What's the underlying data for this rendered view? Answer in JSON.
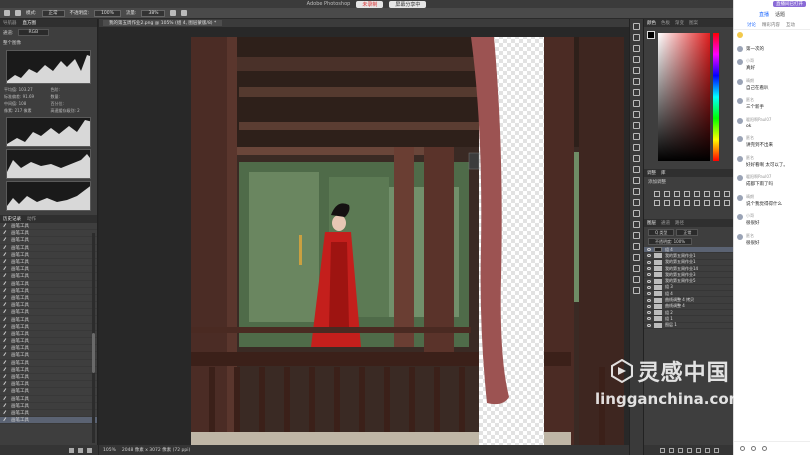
{
  "window": {
    "title": "Adobe Photoshop",
    "record_button": "未录制",
    "share_button": "屏幕分享中"
  },
  "options_bar": {
    "mode_label": "模式:",
    "mode_value": "正常",
    "opacity_label": "不透明度:",
    "opacity_value": "100%",
    "flow_label": "流量:",
    "flow_value": "38%"
  },
  "document": {
    "tab_label": "我的第五周作业2.png @ 105% (组 4, 图层蒙版/8) *",
    "status_zoom": "105%",
    "status_info": "2048 像素 x 3072 像素 (72 ppi)"
  },
  "left_panel": {
    "tabs": [
      "导航器",
      "直方图"
    ],
    "active_tab": "直方图",
    "channel_label": "通道:",
    "channel_value": "RGB",
    "source_label": "整个图像",
    "stats": [
      "平均值: 103.27",
      "色阶:",
      "标准偏差: 91.69",
      "数量:",
      "中间值: 108",
      "百分位:",
      "像素: 217 像素",
      "高速缓存级别: 2"
    ],
    "history_tabs": [
      "历史记录",
      "动作"
    ],
    "history_items": [
      "画笔工具",
      "画笔工具",
      "画笔工具",
      "画笔工具",
      "画笔工具",
      "画笔工具",
      "画笔工具",
      "画笔工具",
      "画笔工具",
      "画笔工具",
      "画笔工具",
      "画笔工具",
      "画笔工具",
      "画笔工具",
      "画笔工具",
      "画笔工具",
      "画笔工具",
      "画笔工具",
      "画笔工具",
      "画笔工具",
      "画笔工具",
      "画笔工具",
      "画笔工具",
      "画笔工具",
      "画笔工具",
      "画笔工具",
      "画笔工具",
      "画笔工具"
    ]
  },
  "right_panel": {
    "color_tabs": [
      "颜色",
      "色板",
      "渐变",
      "图案"
    ],
    "adjust_tabs": [
      "调整",
      "库"
    ],
    "adjust_label": "添加调整",
    "layers_tabs": [
      "图层",
      "通道",
      "路径"
    ],
    "layer_kind": "Q 类型",
    "layer_blend": "正常",
    "layer_opacity": "不透明度: 100%",
    "layers": [
      {
        "name": "组 4",
        "active": true
      },
      {
        "name": "我的第五周作业1",
        "active": false
      },
      {
        "name": "我的第五周作业1",
        "active": false
      },
      {
        "name": "我的第五周作业14",
        "active": false
      },
      {
        "name": "我的第五周作业3",
        "active": false
      },
      {
        "name": "我的第五周作业5",
        "active": false
      },
      {
        "name": "组 3",
        "active": false
      },
      {
        "name": "组 4",
        "active": false
      },
      {
        "name": "曲线调整 4 拷贝",
        "active": false
      },
      {
        "name": "曲线调整 4",
        "active": false
      },
      {
        "name": "组 2",
        "active": false
      },
      {
        "name": "组 1",
        "active": false
      },
      {
        "name": "图层 1",
        "active": false
      }
    ]
  },
  "chat": {
    "badge": "直播间已打开",
    "head_tabs": [
      "直播",
      "话题"
    ],
    "active_head": "直播",
    "sub_tabs": [
      "讨论",
      "精彩内容",
      "互动"
    ],
    "messages": [
      {
        "name": "",
        "text": "第一次的"
      },
      {
        "name": "小哥",
        "text": "真好"
      },
      {
        "name": "晴朗",
        "text": "自己在看叭"
      },
      {
        "name": "匿名",
        "text": "三个新手"
      },
      {
        "name": "暖阳啊Paul07",
        "text": "ok"
      },
      {
        "name": "匿名",
        "text": "讲完到不出来"
      },
      {
        "name": "匿名",
        "text": "好好看啊 太可以了。"
      },
      {
        "name": "暖阳啊Paul07",
        "text": "成都下雨了吗"
      },
      {
        "name": "晴朗",
        "text": "说个我觉得得什么"
      },
      {
        "name": "小哥",
        "text": "很很好"
      },
      {
        "name": "匿名",
        "text": "很很好"
      }
    ]
  },
  "watermark": {
    "cn": "灵感中国",
    "url": "lingganchina.com"
  },
  "colors": {
    "ps_bg": "#262626",
    "panel": "#3e3e3e",
    "accent": "#1a66ff",
    "pillar": "#5a2f2a"
  }
}
